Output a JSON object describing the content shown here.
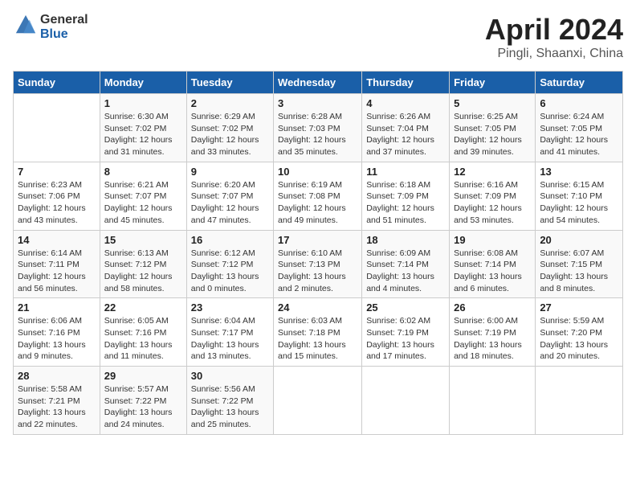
{
  "header": {
    "logo_line1": "General",
    "logo_line2": "Blue",
    "month_year": "April 2024",
    "location": "Pingli, Shaanxi, China"
  },
  "weekdays": [
    "Sunday",
    "Monday",
    "Tuesday",
    "Wednesday",
    "Thursday",
    "Friday",
    "Saturday"
  ],
  "weeks": [
    [
      {
        "day": "",
        "info": ""
      },
      {
        "day": "1",
        "info": "Sunrise: 6:30 AM\nSunset: 7:02 PM\nDaylight: 12 hours\nand 31 minutes."
      },
      {
        "day": "2",
        "info": "Sunrise: 6:29 AM\nSunset: 7:02 PM\nDaylight: 12 hours\nand 33 minutes."
      },
      {
        "day": "3",
        "info": "Sunrise: 6:28 AM\nSunset: 7:03 PM\nDaylight: 12 hours\nand 35 minutes."
      },
      {
        "day": "4",
        "info": "Sunrise: 6:26 AM\nSunset: 7:04 PM\nDaylight: 12 hours\nand 37 minutes."
      },
      {
        "day": "5",
        "info": "Sunrise: 6:25 AM\nSunset: 7:05 PM\nDaylight: 12 hours\nand 39 minutes."
      },
      {
        "day": "6",
        "info": "Sunrise: 6:24 AM\nSunset: 7:05 PM\nDaylight: 12 hours\nand 41 minutes."
      }
    ],
    [
      {
        "day": "7",
        "info": "Sunrise: 6:23 AM\nSunset: 7:06 PM\nDaylight: 12 hours\nand 43 minutes."
      },
      {
        "day": "8",
        "info": "Sunrise: 6:21 AM\nSunset: 7:07 PM\nDaylight: 12 hours\nand 45 minutes."
      },
      {
        "day": "9",
        "info": "Sunrise: 6:20 AM\nSunset: 7:07 PM\nDaylight: 12 hours\nand 47 minutes."
      },
      {
        "day": "10",
        "info": "Sunrise: 6:19 AM\nSunset: 7:08 PM\nDaylight: 12 hours\nand 49 minutes."
      },
      {
        "day": "11",
        "info": "Sunrise: 6:18 AM\nSunset: 7:09 PM\nDaylight: 12 hours\nand 51 minutes."
      },
      {
        "day": "12",
        "info": "Sunrise: 6:16 AM\nSunset: 7:09 PM\nDaylight: 12 hours\nand 53 minutes."
      },
      {
        "day": "13",
        "info": "Sunrise: 6:15 AM\nSunset: 7:10 PM\nDaylight: 12 hours\nand 54 minutes."
      }
    ],
    [
      {
        "day": "14",
        "info": "Sunrise: 6:14 AM\nSunset: 7:11 PM\nDaylight: 12 hours\nand 56 minutes."
      },
      {
        "day": "15",
        "info": "Sunrise: 6:13 AM\nSunset: 7:12 PM\nDaylight: 12 hours\nand 58 minutes."
      },
      {
        "day": "16",
        "info": "Sunrise: 6:12 AM\nSunset: 7:12 PM\nDaylight: 13 hours\nand 0 minutes."
      },
      {
        "day": "17",
        "info": "Sunrise: 6:10 AM\nSunset: 7:13 PM\nDaylight: 13 hours\nand 2 minutes."
      },
      {
        "day": "18",
        "info": "Sunrise: 6:09 AM\nSunset: 7:14 PM\nDaylight: 13 hours\nand 4 minutes."
      },
      {
        "day": "19",
        "info": "Sunrise: 6:08 AM\nSunset: 7:14 PM\nDaylight: 13 hours\nand 6 minutes."
      },
      {
        "day": "20",
        "info": "Sunrise: 6:07 AM\nSunset: 7:15 PM\nDaylight: 13 hours\nand 8 minutes."
      }
    ],
    [
      {
        "day": "21",
        "info": "Sunrise: 6:06 AM\nSunset: 7:16 PM\nDaylight: 13 hours\nand 9 minutes."
      },
      {
        "day": "22",
        "info": "Sunrise: 6:05 AM\nSunset: 7:16 PM\nDaylight: 13 hours\nand 11 minutes."
      },
      {
        "day": "23",
        "info": "Sunrise: 6:04 AM\nSunset: 7:17 PM\nDaylight: 13 hours\nand 13 minutes."
      },
      {
        "day": "24",
        "info": "Sunrise: 6:03 AM\nSunset: 7:18 PM\nDaylight: 13 hours\nand 15 minutes."
      },
      {
        "day": "25",
        "info": "Sunrise: 6:02 AM\nSunset: 7:19 PM\nDaylight: 13 hours\nand 17 minutes."
      },
      {
        "day": "26",
        "info": "Sunrise: 6:00 AM\nSunset: 7:19 PM\nDaylight: 13 hours\nand 18 minutes."
      },
      {
        "day": "27",
        "info": "Sunrise: 5:59 AM\nSunset: 7:20 PM\nDaylight: 13 hours\nand 20 minutes."
      }
    ],
    [
      {
        "day": "28",
        "info": "Sunrise: 5:58 AM\nSunset: 7:21 PM\nDaylight: 13 hours\nand 22 minutes."
      },
      {
        "day": "29",
        "info": "Sunrise: 5:57 AM\nSunset: 7:22 PM\nDaylight: 13 hours\nand 24 minutes."
      },
      {
        "day": "30",
        "info": "Sunrise: 5:56 AM\nSunset: 7:22 PM\nDaylight: 13 hours\nand 25 minutes."
      },
      {
        "day": "",
        "info": ""
      },
      {
        "day": "",
        "info": ""
      },
      {
        "day": "",
        "info": ""
      },
      {
        "day": "",
        "info": ""
      }
    ]
  ]
}
